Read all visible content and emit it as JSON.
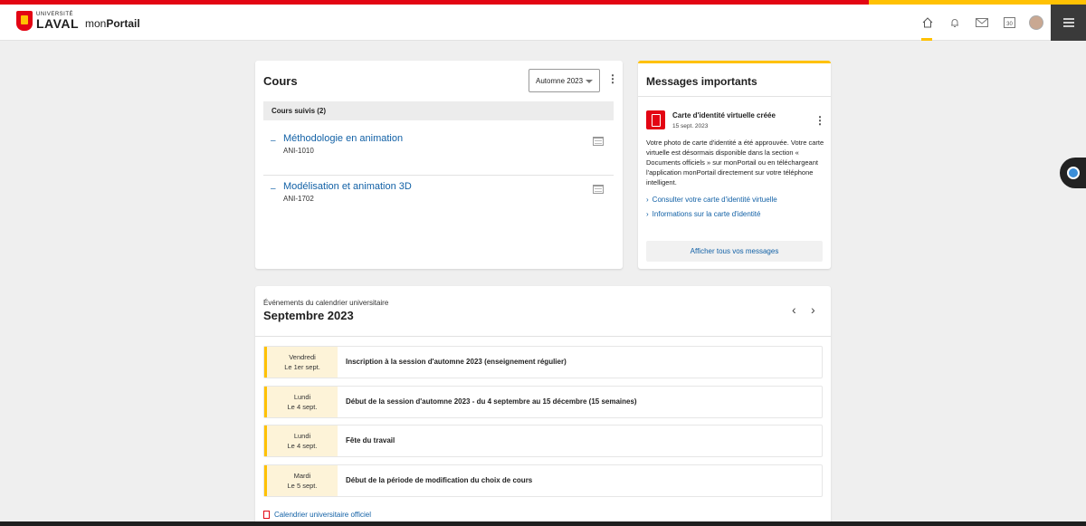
{
  "header": {
    "logo_small": "UNIVERSITÉ",
    "logo_big": "LAVAL",
    "app_prefix": "mon",
    "app_suffix": "Portail",
    "calendar_day": "30"
  },
  "cours": {
    "title": "Cours",
    "session": "Automne 2023",
    "followed": "Cours suivis (2)",
    "items": [
      {
        "title": "Méthodologie en animation",
        "code": "ANI-1010"
      },
      {
        "title": "Modélisation et animation 3D",
        "code": "ANI-1702"
      }
    ]
  },
  "messages": {
    "title": "Messages importants",
    "item_title": "Carte d'identité virtuelle créée",
    "item_date": "15 sept. 2023",
    "item_body": "Votre photo de carte d'identité a été approuvée. Votre carte virtuelle est désormais disponible dans la section « Documents officiels » sur monPortail ou en téléchargeant l'application monPortail directement sur votre téléphone intelligent.",
    "links": [
      "Consulter votre carte d'identité virtuelle",
      "Informations sur la carte d'identité"
    ],
    "all_button": "Afficher tous vos messages"
  },
  "calendar": {
    "subtitle": "Événements du calendrier universitaire",
    "month": "Septembre 2023",
    "events": [
      {
        "weekday": "Vendredi",
        "date": "Le 1er sept.",
        "label": "Inscription à la session d'automne 2023 (enseignement régulier)"
      },
      {
        "weekday": "Lundi",
        "date": "Le 4 sept.",
        "label": "Début de la session d'automne 2023 - du 4 septembre au 15 décembre (15 semaines)"
      },
      {
        "weekday": "Lundi",
        "date": "Le 4 sept.",
        "label": "Fête du travail"
      },
      {
        "weekday": "Mardi",
        "date": "Le 5 sept.",
        "label": "Début de la période de modification du choix de cours"
      }
    ],
    "official_link": "Calendrier universitaire officiel"
  },
  "colors": {
    "accent_red": "#e30513",
    "accent_gold": "#ffc103",
    "link_blue": "#1261a6"
  },
  "icons": [
    "home-icon",
    "bell-icon",
    "mail-icon",
    "calendar-icon",
    "menu-icon"
  ]
}
